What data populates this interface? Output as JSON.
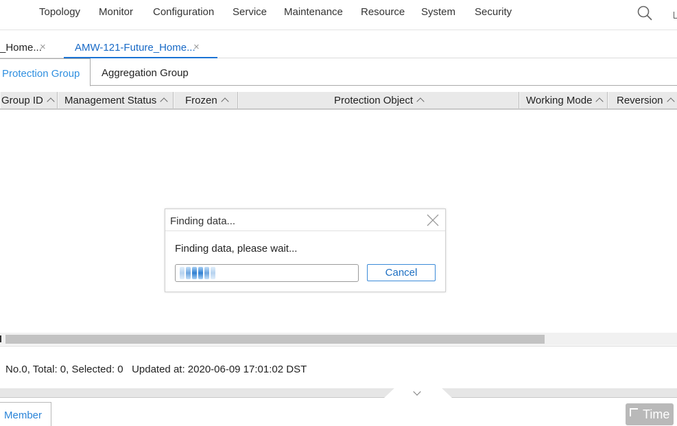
{
  "menu": {
    "items": [
      "Topology",
      "Monitor",
      "Configuration",
      "Service",
      "Maintenance",
      "Resource",
      "System",
      "Security"
    ]
  },
  "doc_tabs": [
    {
      "label": "_Home...",
      "close": "×",
      "active": false
    },
    {
      "label": "AMW-121-Future_Home...",
      "close": "×",
      "active": true
    }
  ],
  "sub_tabs": [
    {
      "label": "Protection Group",
      "active": true
    },
    {
      "label": "Aggregation Group",
      "active": false
    }
  ],
  "table": {
    "columns": [
      "Group ID",
      "Management Status",
      "Frozen",
      "Protection Object",
      "Working Mode",
      "Reversion"
    ]
  },
  "dialog": {
    "title": "Finding data...",
    "message": "Finding data, please wait...",
    "cancel_label": "Cancel"
  },
  "status": {
    "no": "No.0",
    "total": "Total: 0",
    "selected": "Selected: 0",
    "updated": "Updated at: 2020-06-09 17:01:02 DST"
  },
  "bottom": {
    "member_label": "Member",
    "time_label": "Time"
  },
  "icons": {
    "search": "search-icon",
    "close": "close-icon",
    "sort": "sort-asc-icon",
    "collapse": "chevron-down-icon"
  },
  "colors": {
    "accent": "#1a73d4",
    "subtab_active": "#2f8fe0",
    "progress": "#2f7fd1"
  }
}
